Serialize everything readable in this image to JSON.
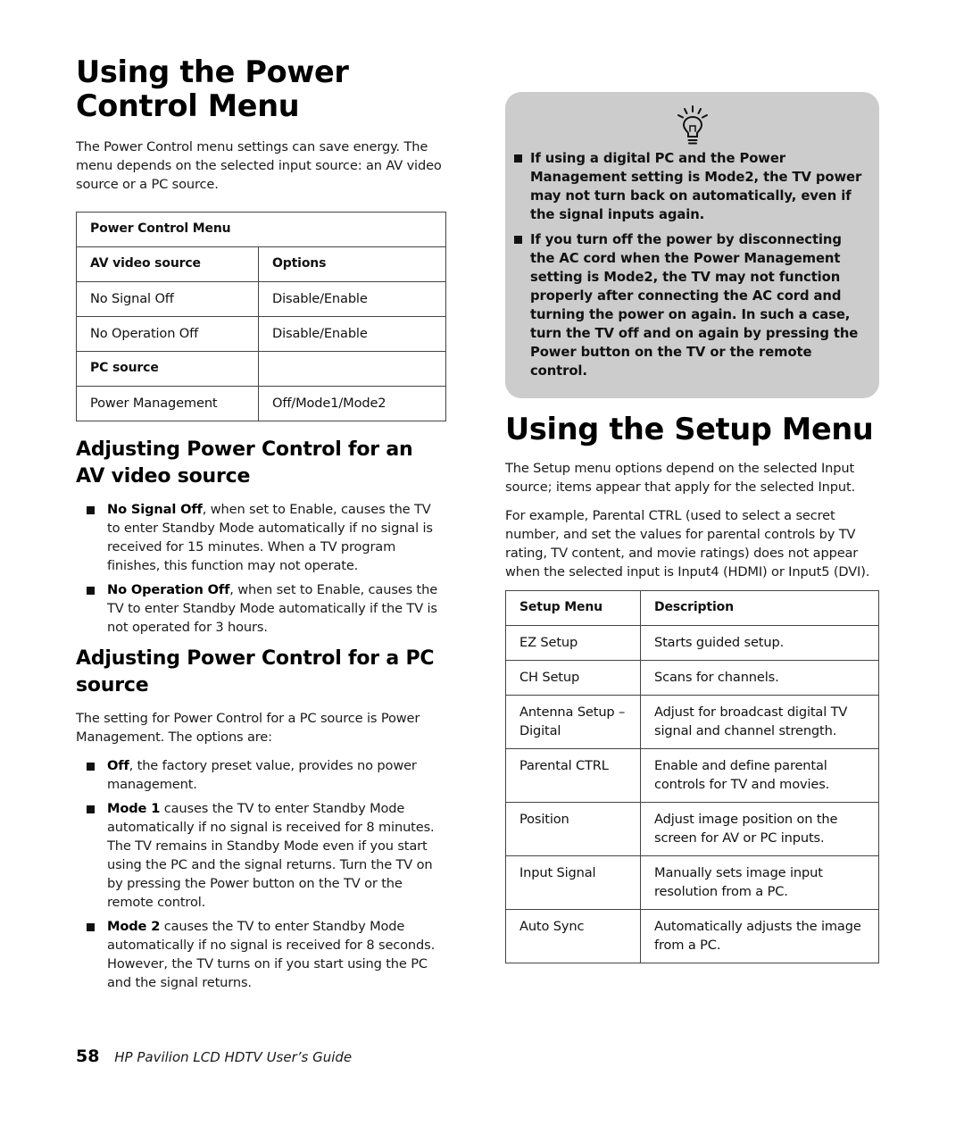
{
  "left": {
    "heading": "Using the Power Control Menu",
    "intro": "The Power Control menu settings can save energy. The menu depends on the selected input source: an AV video source or a PC source.",
    "table": {
      "title": "Power Control Menu",
      "header": [
        "AV video source",
        "Options"
      ],
      "rows": [
        [
          "No Signal Off",
          "Disable/Enable"
        ],
        [
          "No Operation Off",
          "Disable/Enable"
        ]
      ],
      "section2_label": "PC source",
      "rows2": [
        [
          "Power Management",
          "Off/Mode1/Mode2"
        ]
      ]
    },
    "av_section": {
      "heading": "Adjusting Power Control for an AV video source",
      "bullets": [
        {
          "bold": "No Signal Off",
          "text": ", when set to Enable, causes the TV to enter Standby Mode automatically if no signal is received for 15 minutes. When a TV program finishes, this function may not operate."
        },
        {
          "bold": "No Operation Off",
          "text": ", when set to Enable, causes the TV to enter Standby Mode automatically if the TV is not operated for 3 hours."
        }
      ]
    },
    "pc_section": {
      "heading": "Adjusting Power Control for a PC source",
      "intro": "The setting for Power Control for a PC source is Power Management. The options are:",
      "bullets": [
        {
          "bold": "Off",
          "text": ", the factory preset value, provides no power management."
        },
        {
          "bold": "Mode 1",
          "text": " causes the TV to enter Standby Mode automatically if no signal is received for 8 minutes. The TV remains in Standby Mode even if you start using the PC and the signal returns. Turn the TV on by pressing the Power button on the TV or the remote control."
        },
        {
          "bold": "Mode 2",
          "text": " causes the TV to enter Standby Mode automatically if no signal is received for 8 seconds. However, the TV turns on if you start using the PC and the signal returns."
        }
      ]
    }
  },
  "tip": {
    "icon": "lightbulb-icon",
    "items": [
      "If using a digital PC and the Power Management setting is Mode2, the TV power may not turn back on automatically, even if the signal inputs again.",
      "If you turn off the power by disconnecting the AC cord when the Power Management setting is Mode2, the TV may not function properly after connecting the AC cord and turning the power on again. In such a case, turn the TV off and on again by pressing the Power button on the TV or the remote control."
    ]
  },
  "right": {
    "heading": "Using the Setup Menu",
    "para1": "The Setup menu options depend on the selected Input source; items appear that apply for the selected Input.",
    "para2": "For example, Parental CTRL (used to select a secret number, and set the values for parental controls by TV rating, TV content, and movie ratings) does not appear when the selected input is Input4 (HDMI) or Input5 (DVI).",
    "table": {
      "header": [
        "Setup Menu",
        "Description"
      ],
      "rows": [
        [
          "EZ Setup",
          "Starts guided setup."
        ],
        [
          "CH Setup",
          "Scans for channels."
        ],
        [
          "Antenna Setup – Digital",
          "Adjust for broadcast digital TV signal and channel strength."
        ],
        [
          "Parental CTRL",
          "Enable and define parental controls for TV and movies."
        ],
        [
          "Position",
          "Adjust image position on the screen for AV or PC inputs."
        ],
        [
          "Input Signal",
          "Manually sets image input resolution from a PC."
        ],
        [
          "Auto Sync",
          "Automatically adjusts the image from a PC."
        ]
      ]
    }
  },
  "footer": {
    "page_number": "58",
    "title": "HP Pavilion LCD HDTV User’s Guide"
  }
}
